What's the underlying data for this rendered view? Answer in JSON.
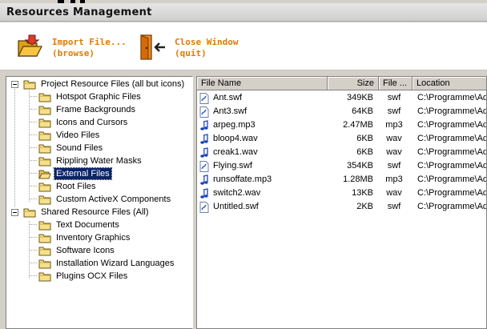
{
  "window": {
    "title": "Resources Management"
  },
  "toolbar": {
    "import_label": "Import File...",
    "import_sub": "(browse)",
    "close_label": "Close Window",
    "close_sub": "(quit)",
    "accent": "#e07b00"
  },
  "tree": {
    "groups": [
      {
        "label": "Project Resource Files (all but icons)",
        "children": [
          "Hotspot Graphic Files",
          "Frame Backgrounds",
          "Icons and Cursors",
          "Video Files",
          "Sound Files",
          "Rippling Water Masks",
          "External Files",
          "Root Files",
          "Custom ActiveX Components"
        ]
      },
      {
        "label": "Shared Resource Files (All)",
        "children": [
          "Text Documents",
          "Inventory Graphics",
          "Software Icons",
          "Installation Wizard Languages",
          "Plugins OCX Files"
        ]
      }
    ],
    "selected": "External Files",
    "selection_color": "#0a246a"
  },
  "filelist": {
    "columns": [
      "File Name",
      "Size",
      "File ...",
      "Location"
    ],
    "rows": [
      {
        "name": "Ant.swf",
        "size": "349KB",
        "type": "swf",
        "location": "C:\\Programme\\Ad",
        "icon": "flash-file-icon"
      },
      {
        "name": "Ant3.swf",
        "size": "64KB",
        "type": "swf",
        "location": "C:\\Programme\\Ad",
        "icon": "flash-file-icon"
      },
      {
        "name": "arpeg.mp3",
        "size": "2.47MB",
        "type": "mp3",
        "location": "C:\\Programme\\Ad",
        "icon": "audio-file-icon"
      },
      {
        "name": "bloop4.wav",
        "size": "6KB",
        "type": "wav",
        "location": "C:\\Programme\\Ad",
        "icon": "audio-file-icon"
      },
      {
        "name": "creak1.wav",
        "size": "6KB",
        "type": "wav",
        "location": "C:\\Programme\\Ad",
        "icon": "audio-file-icon"
      },
      {
        "name": "Flying.swf",
        "size": "354KB",
        "type": "swf",
        "location": "C:\\Programme\\Ad",
        "icon": "flash-file-icon"
      },
      {
        "name": "runsoffate.mp3",
        "size": "1.28MB",
        "type": "mp3",
        "location": "C:\\Programme\\Ad",
        "icon": "audio-file-icon"
      },
      {
        "name": "switch2.wav",
        "size": "13KB",
        "type": "wav",
        "location": "C:\\Programme\\Ad",
        "icon": "audio-file-icon"
      },
      {
        "name": "Untitled.swf",
        "size": "2KB",
        "type": "swf",
        "location": "C:\\Programme\\Ad",
        "icon": "flash-file-icon"
      }
    ]
  }
}
